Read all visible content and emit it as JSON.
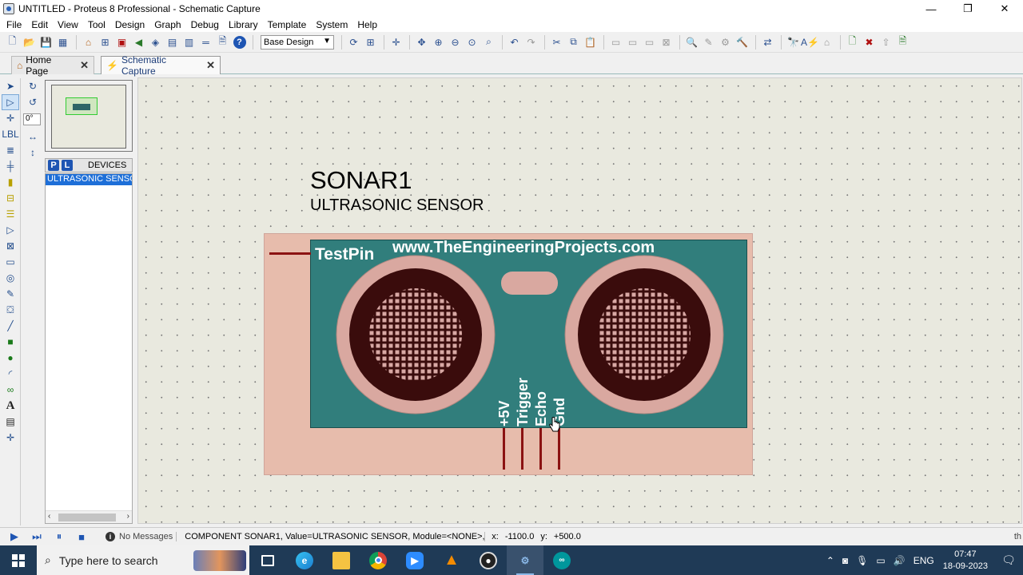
{
  "window": {
    "title": "UNTITLED - Proteus 8 Professional - Schematic Capture",
    "minimize": "—",
    "maximize": "❐",
    "close": "✕"
  },
  "menu": [
    "File",
    "Edit",
    "View",
    "Tool",
    "Design",
    "Graph",
    "Debug",
    "Library",
    "Template",
    "System",
    "Help"
  ],
  "toolbar": {
    "design_select": "Base Design"
  },
  "tabs": [
    {
      "label": "Home Page"
    },
    {
      "label": "Schematic Capture"
    }
  ],
  "sidebar": {
    "angle_value": "0°",
    "devices_header": "DEVICES",
    "p_button": "P",
    "l_button": "L",
    "devices": [
      "ULTRASONIC SENSOR"
    ]
  },
  "component": {
    "reference": "SONAR1",
    "value": "ULTRASONIC SENSOR",
    "testpin_label": "TestPin",
    "website": "www.TheEngineeringProjects.com",
    "pins": [
      "+5V",
      "Trigger",
      "Echo",
      "Gnd"
    ]
  },
  "colors": {
    "board": "#317e7c",
    "body": "#e7bcac",
    "pin_wire": "#8b1212",
    "transducer_ring": "#d9a8a0",
    "transducer_dark": "#3a0c0c"
  },
  "statusbar": {
    "messages": "No Messages",
    "component_info": "COMPONENT SONAR1, Value=ULTRASONIC SENSOR, Module=<NONE>, Devic",
    "x_label": "x:",
    "x_value": "-1100.0",
    "y_label": "y:",
    "y_value": "+500.0",
    "trailing": "th"
  },
  "taskbar": {
    "search_placeholder": "Type here to search",
    "language": "ENG",
    "time": "07:47",
    "date": "18-09-2023"
  }
}
